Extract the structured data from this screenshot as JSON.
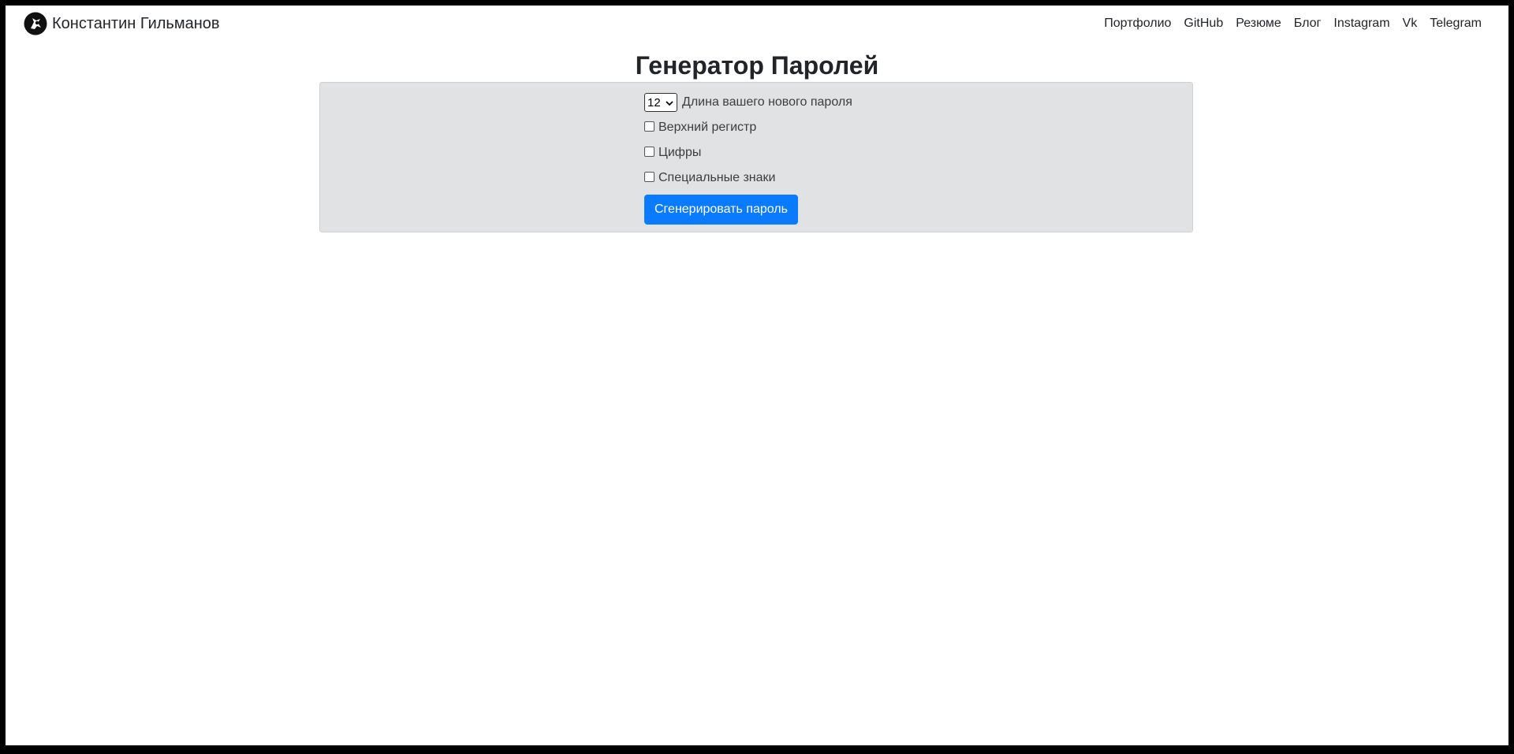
{
  "navbar": {
    "brand_name": "Константин Гильманов",
    "links": [
      "Портфолио",
      "GitHub",
      "Резюме",
      "Блог",
      "Instagram",
      "Vk",
      "Telegram"
    ]
  },
  "main": {
    "title": "Генератор Паролей",
    "length_select": {
      "value": "12",
      "label": "Длина вашего нового пароля"
    },
    "options": [
      {
        "label": "Верхний регистр",
        "checked": false
      },
      {
        "label": "Цифры",
        "checked": false
      },
      {
        "label": "Специальные знаки",
        "checked": false
      }
    ],
    "generate_button": "Сгенерировать пароль"
  },
  "colors": {
    "panel_background": "#e1e2e4",
    "button_primary": "#0a7bff",
    "frame_border": "#000000"
  }
}
